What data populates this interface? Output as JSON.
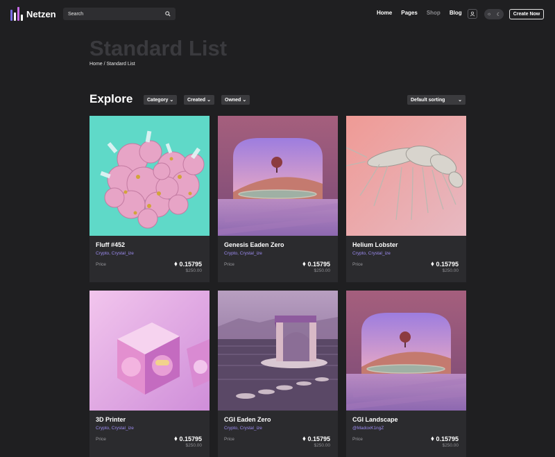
{
  "brand": {
    "name": "Netzen",
    "bar_colors": [
      "#7b6fe6",
      "#ffffff",
      "#c76ce8",
      "#ffffff"
    ]
  },
  "search": {
    "placeholder": "Search",
    "icon": "search-icon"
  },
  "nav": {
    "items": [
      "Home",
      "Pages",
      "Shop",
      "Blog"
    ],
    "active_muted": "Shop",
    "create_label": "Create Now"
  },
  "page": {
    "hero_title": "Standard List",
    "breadcrumb": "Home / Standard List"
  },
  "explore": {
    "heading": "Explore",
    "filters": [
      "Category",
      "Created",
      "Owned"
    ],
    "sort_label": "Default sorting"
  },
  "cards": [
    {
      "title": "Fluff #452",
      "tags": "Crypto, Crystal_ize",
      "price_label": "Price",
      "price_eth": "0.15795",
      "price_usd": "$250.00",
      "art": "pink-blobs"
    },
    {
      "title": "Genesis Eaden Zero",
      "tags": "Crypto, Crystal_ize",
      "price_label": "Price",
      "price_eth": "0.15795",
      "price_usd": "$250.00",
      "art": "arch-landscape"
    },
    {
      "title": "Helium Lobster",
      "tags": "Crypto, Crystal_ize",
      "price_label": "Price",
      "price_eth": "0.15795",
      "price_usd": "$250.00",
      "art": "lobster"
    },
    {
      "title": "3D Printer",
      "tags": "Crypto, Crystal_ize",
      "price_label": "Price",
      "price_eth": "0.15795",
      "price_usd": "$250.00",
      "art": "pink-cubes"
    },
    {
      "title": "CGI Eaden Zero",
      "tags": "Crypto, Crystal_ize",
      "price_label": "Price",
      "price_eth": "0.15795",
      "price_usd": "$250.00",
      "art": "gazebo-water"
    },
    {
      "title": "CGI Landscape",
      "tags": "@MadoxK1ngZ",
      "price_label": "Price",
      "price_eth": "0.15795",
      "price_usd": "$250.00",
      "art": "arch-landscape"
    }
  ],
  "colors": {
    "accent": "#9d8cf2",
    "background": "#1f1f21",
    "card": "#2b2b2e"
  }
}
